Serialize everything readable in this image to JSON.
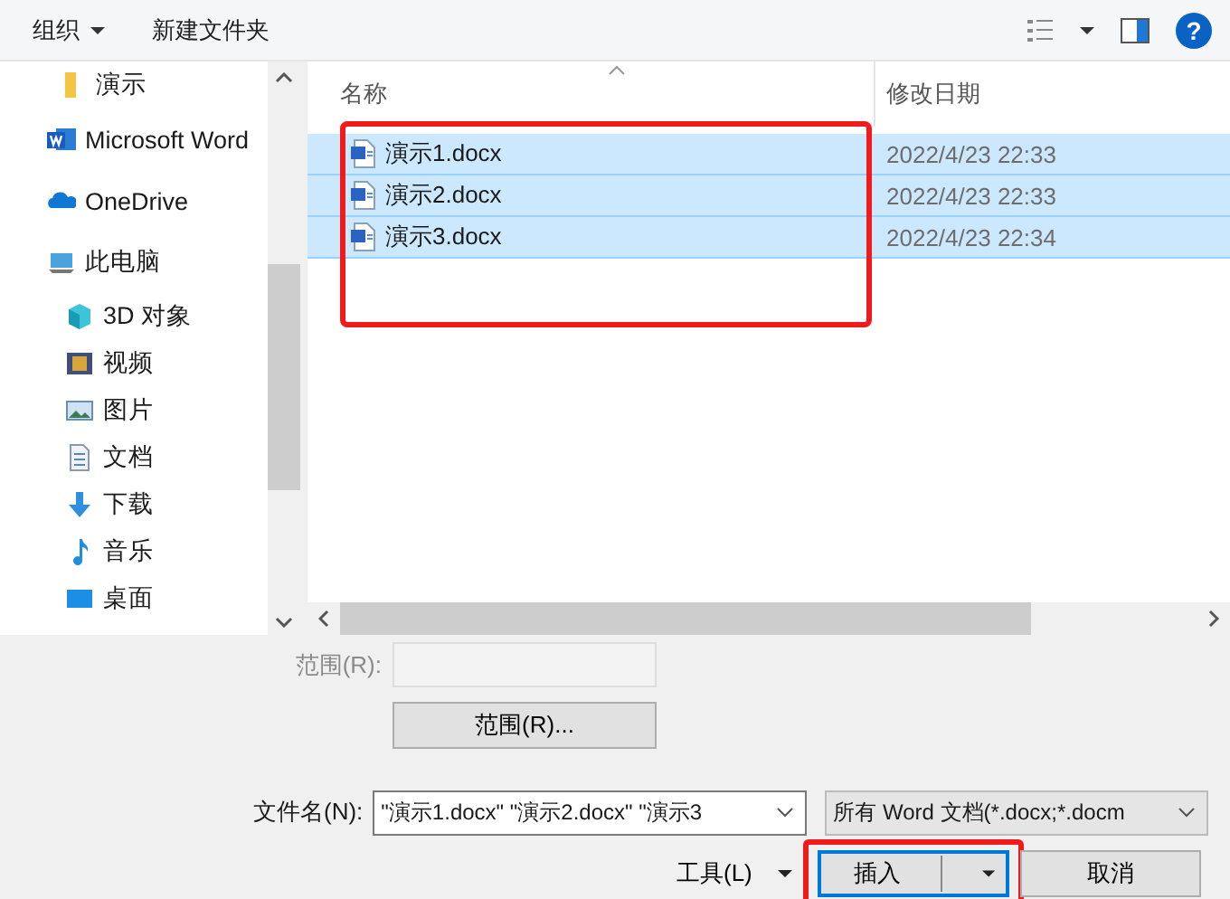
{
  "toolbar": {
    "organize": "组织",
    "new_folder": "新建文件夹",
    "help": "?"
  },
  "sidebar": {
    "items": [
      {
        "label": "演示",
        "kind": "folder"
      },
      {
        "label": "Microsoft Word",
        "kind": "word"
      },
      {
        "label": "OneDrive",
        "kind": "onedrive"
      },
      {
        "label": "此电脑",
        "kind": "pc",
        "children": [
          {
            "label": "3D 对象",
            "kind": "cube"
          },
          {
            "label": "视频",
            "kind": "video"
          },
          {
            "label": "图片",
            "kind": "pictures"
          },
          {
            "label": "文档",
            "kind": "documents"
          },
          {
            "label": "下载",
            "kind": "downloads"
          },
          {
            "label": "音乐",
            "kind": "music"
          },
          {
            "label": "桌面",
            "kind": "desktop"
          }
        ]
      }
    ]
  },
  "file_list": {
    "columns": [
      "名称",
      "修改日期"
    ],
    "rows": [
      {
        "name": "演示1.docx",
        "modified": "2022/4/23 22:33",
        "selected": true
      },
      {
        "name": "演示2.docx",
        "modified": "2022/4/23 22:33",
        "selected": true
      },
      {
        "name": "演示3.docx",
        "modified": "2022/4/23 22:34",
        "selected": true
      }
    ]
  },
  "range": {
    "label": "范围(R):",
    "disabled": true,
    "button": "范围(R)..."
  },
  "filename": {
    "label": "文件名(N):",
    "value": "\"演示1.docx\" \"演示2.docx\" \"演示3"
  },
  "file_type": "所有 Word 文档(*.docx;*.docm",
  "buttons": {
    "tools": "工具(L)",
    "insert": "插入",
    "cancel": "取消"
  }
}
